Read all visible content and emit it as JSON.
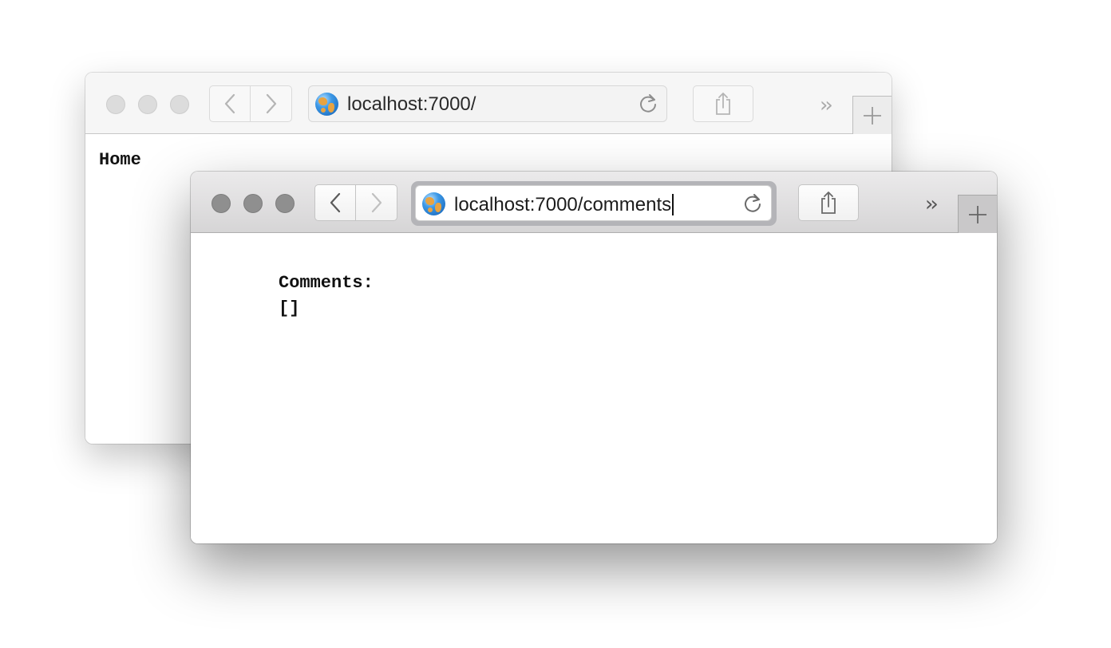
{
  "back_window": {
    "url": "localhost:7000/",
    "page_text": "Home"
  },
  "front_window": {
    "url": "localhost:7000/comments",
    "comments_label": "Comments:",
    "comments_value": "[]"
  },
  "icons": {
    "back": "chevron-left-icon",
    "forward": "chevron-right-icon",
    "site": "globe-icon",
    "reload": "reload-icon",
    "share": "share-icon",
    "overflow": "chevron-double-right-icon",
    "new_tab": "plus-icon"
  },
  "colors": {
    "traffic_light_inactive": "#dcdcdc",
    "traffic_light_active_unfocused": "#8f8f8f",
    "focus_ring": "#b4b4b8"
  }
}
